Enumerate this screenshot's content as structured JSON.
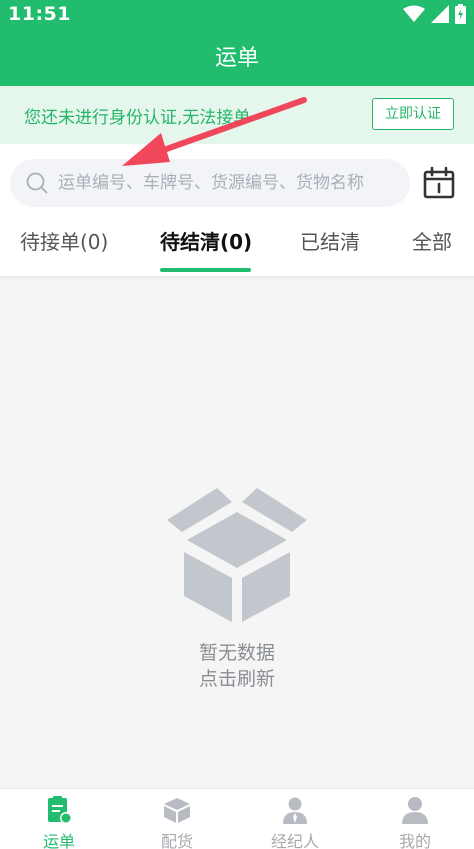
{
  "status_bar": {
    "time": "11:51"
  },
  "header": {
    "title": "运单"
  },
  "banner": {
    "message": "您还未进行身份认证,无法接单",
    "action_label": "立即认证"
  },
  "search": {
    "placeholder": "运单编号、车牌号、货源编号、货物名称"
  },
  "tabs": [
    {
      "label": "待接单(0)",
      "active": false
    },
    {
      "label": "待结清(0)",
      "active": true
    },
    {
      "label": "已结清",
      "active": false
    },
    {
      "label": "全部",
      "active": false
    }
  ],
  "empty_state": {
    "line1": "暂无数据",
    "line2": "点击刷新"
  },
  "bottom_nav": [
    {
      "label": "运单",
      "icon": "waybill-icon",
      "active": true
    },
    {
      "label": "配货",
      "icon": "box-icon",
      "active": false
    },
    {
      "label": "经纪人",
      "icon": "broker-icon",
      "active": false
    },
    {
      "label": "我的",
      "icon": "profile-icon",
      "active": false
    }
  ],
  "colors": {
    "brand": "#22bc6f",
    "banner_bg": "#e5f7ec",
    "arrow": "#f0485a"
  }
}
